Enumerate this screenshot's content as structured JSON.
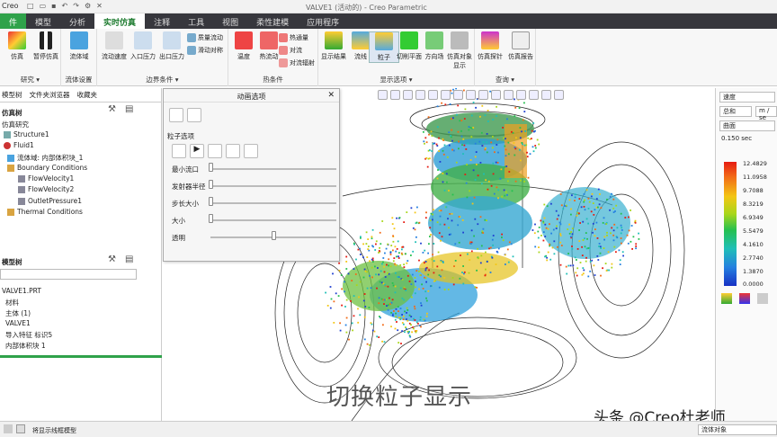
{
  "titlebar": {
    "app_logo": "Creo",
    "window_title": "VALVE1 (活动的) - Creo Parametric",
    "qat_icons": [
      "new-icon",
      "open-icon",
      "save-icon",
      "undo-icon",
      "redo-icon",
      "regenerate-icon",
      "close-window-icon"
    ]
  },
  "ribbon_tabs": [
    "件",
    "模型",
    "分析",
    "实时仿真",
    "注释",
    "工具",
    "视图",
    "柔性建模",
    "应用程序"
  ],
  "ribbon": {
    "groups": {
      "study": {
        "label": "研究 ▾"
      },
      "fluid_setup": {
        "label": "流体设置"
      },
      "boundary": {
        "label": "边界条件 ▾"
      },
      "thermal": {
        "label": "热条件"
      },
      "display_options": {
        "label": "显示选项 ▾"
      },
      "query": {
        "label": "查询 ▾"
      }
    },
    "buttons": {
      "simulate": "仿真",
      "pause": "暂停仿真",
      "fluid_domain": "流体域",
      "flow_velocity": "流动速度",
      "inlet_pressure": "入口压力",
      "outlet_pressure": "出口压力",
      "mass_flow": "质量流动",
      "slip_wall": "滑动对称",
      "temperature": "温度",
      "heat_flow": "热流动",
      "heat_flux": "热通量",
      "convection": "对流",
      "convection_radiation": "对流辐射",
      "show_results": "显示结果",
      "streamline": "流线",
      "particles": "粒子",
      "cut_plane": "切削平面",
      "direction_field": "方向场",
      "sim_object_display": "仿真对象显示",
      "sim_probe": "仿真探针",
      "sim_report": "仿真报告"
    }
  },
  "left_panel": {
    "tabs": [
      "模型树",
      "文件夹浏览器",
      "收藏夹"
    ],
    "sim_tree_header": "仿真树",
    "sim_tree": [
      {
        "label": "仿真研究"
      },
      {
        "label": "Structure1"
      },
      {
        "label": "Fluid1"
      },
      {
        "label": "流体域: 内部体积块_1"
      },
      {
        "label": "Boundary Conditions"
      },
      {
        "label": "FlowVelocity1"
      },
      {
        "label": "FlowVelocity2"
      },
      {
        "label": "OutletPressure1"
      },
      {
        "label": "Thermal Conditions"
      }
    ],
    "model_tree_header": "模型树",
    "model_tree": [
      {
        "label": "VALVE1.PRT"
      },
      {
        "label": "材料"
      },
      {
        "label": "主体 (1)"
      },
      {
        "label": "VALVE1"
      },
      {
        "label": "导入特征 标识5"
      },
      {
        "label": "内部体积块 1"
      }
    ]
  },
  "animation_dialog": {
    "title": "动画选项",
    "section_label": "粒子选项",
    "sliders": [
      {
        "label": "最小流口",
        "value": 0.0
      },
      {
        "label": "发射器半径",
        "value": 0.0
      },
      {
        "label": "步长大小",
        "value": 0.0
      },
      {
        "label": "大小",
        "value": 0.0
      },
      {
        "label": "透明",
        "value": 0.5
      }
    ]
  },
  "right_panel": {
    "quantity": "速度",
    "component": "总和",
    "unit": "m / se",
    "display_type": "曲面",
    "time": "0.150 sec",
    "legend_values": [
      "12.4829",
      "11.0958",
      "9.7088",
      "8.3219",
      "6.9349",
      "5.5479",
      "4.1610",
      "2.7740",
      "1.3870",
      "0.0000"
    ]
  },
  "viewport": {
    "caption": "切换粒子显示",
    "watermark": "头条 @Creo杜老师"
  },
  "status": {
    "message": "将显示线框模型",
    "filter": "流体对象"
  },
  "colors": {
    "accent_green": "#2fa24a",
    "ribbon_tab_bg": "#37373d",
    "legend_max": "#e61b12",
    "legend_min": "#1730c4"
  }
}
